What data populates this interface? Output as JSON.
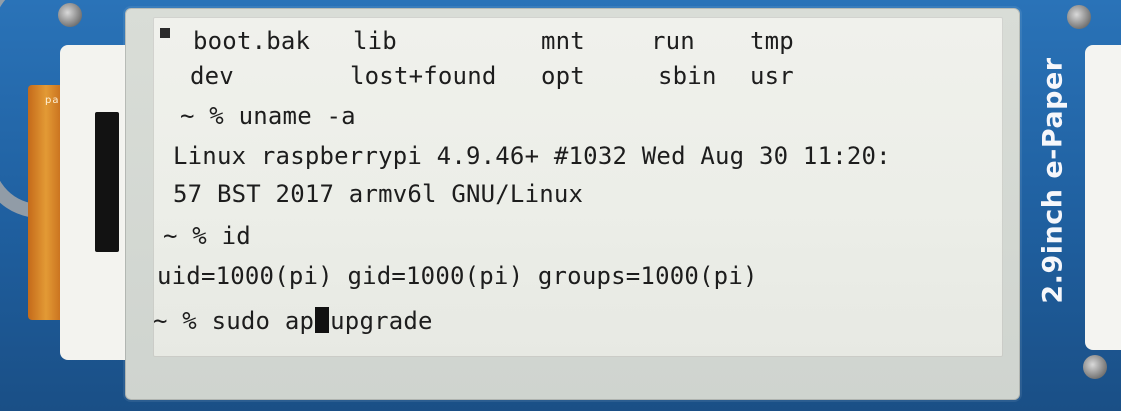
{
  "device": {
    "brand_label": "2.9inch e-Paper",
    "ribbon_label": "pal"
  },
  "terminal": {
    "ls_row1": [
      "boot.bak",
      "lib",
      "mnt",
      "run",
      "tmp"
    ],
    "ls_row2": [
      "dev",
      "lost+found",
      "opt",
      "sbin",
      "usr"
    ],
    "prompt1": "~ % uname -a",
    "uname_line1": "Linux raspberrypi 4.9.46+ #1032 Wed Aug 30 11:20:",
    "uname_line2": "57 BST 2017 armv6l GNU/Linux",
    "prompt2": "~ % id",
    "id_output": "uid=1000(pi) gid=1000(pi) groups=1000(pi)",
    "prompt3_before_cursor": "~ % sudo ap",
    "prompt3_after_cursor": "upgrade"
  }
}
